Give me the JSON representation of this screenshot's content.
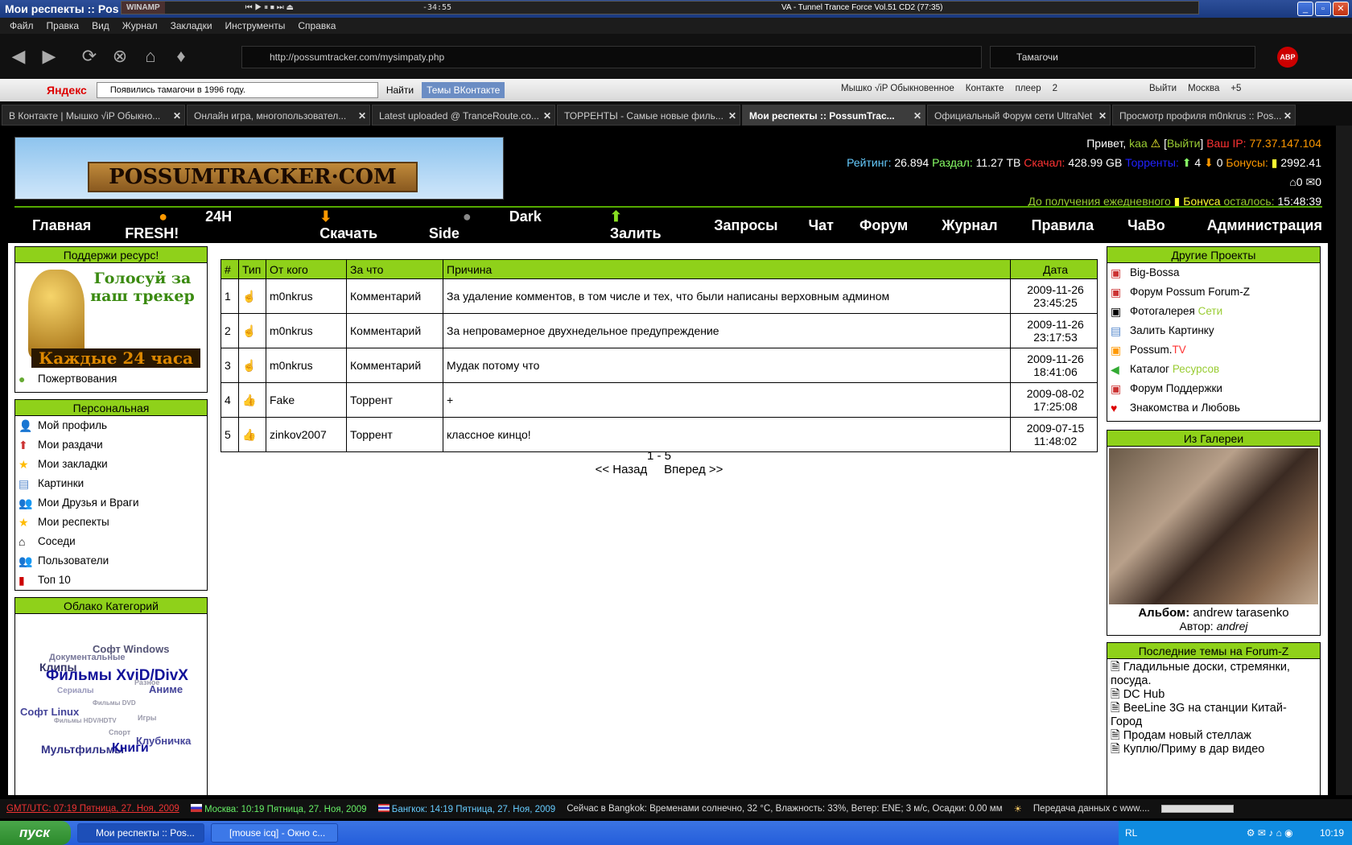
{
  "titlebar": {
    "title": "Мои респекты :: Pos",
    "winamp_label": "WINAMP",
    "winamp_time": "-34:55",
    "track": "VA - Tunnel Trance Force Vol.51 CD2 (77:35)"
  },
  "menu": [
    "Файл",
    "Правка",
    "Вид",
    "Журнал",
    "Закладки",
    "Инструменты",
    "Справка"
  ],
  "url": "http://possumtracker.com/mysimpaty.php",
  "search": "Тамагочи",
  "yandex": {
    "logo": "Яндекс",
    "query": "Появились тамагочи в 1996 году.",
    "find": "Найти",
    "vk_topics": "Темы ВКонтакте",
    "right": [
      "Мышко √iP Обыкновенное",
      "Контакте",
      "плеер",
      "2",
      "Выйти",
      "Москва",
      "+5"
    ]
  },
  "tabs": [
    "В Контакте | Мышко √iP Обыкно...",
    "Онлайн игра, многопользовател...",
    "Latest uploaded @ TranceRoute.co...",
    "ТОРРЕНТЫ - Самые новые филь...",
    "Мои респекты :: PossumTrac...",
    "Официальный Форум сети UltraNet",
    "Просмотр профиля m0nkrus :: Pos..."
  ],
  "banner": "POSSUMTRACKER·COM",
  "user": {
    "hello": "Привет,",
    "name": "kaa",
    "logout": "Выйти",
    "ip_label": "Ваш IP:",
    "ip": "77.37.147.104",
    "rating_label": "Рейтинг:",
    "rating": "26.894",
    "up_label": "Раздал:",
    "up": "11.27 TB",
    "down_label": "Скачал:",
    "down": "428.99 GB",
    "torrents_label": "Торренты:",
    "t_up": "4",
    "t_down": "0",
    "bonus_label": "Бонусы:",
    "bonus": "2992.41",
    "inbox": "0",
    "outbox": "0",
    "daily_1": "До получения ежедневного",
    "daily_2": "Бонуса",
    "daily_3": "осталось:",
    "daily_time": "15:48:39"
  },
  "nav": [
    "Главная",
    "24H FRESH!",
    "Скачать",
    "Dark Side",
    "Залить",
    "Запросы",
    "Чат",
    "Форум",
    "Журнал",
    "Правила",
    "ЧаВо",
    "Администрация"
  ],
  "support": {
    "title": "Поддержи ресурс!",
    "vote": "Голосуй за наш трекер",
    "every": "Каждые 24 часа",
    "donate": "Пожертвования"
  },
  "personal": {
    "title": "Персональная",
    "items": [
      "Мой профиль",
      "Мои раздачи",
      "Мои закладки",
      "Картинки",
      "Мои Друзья и Враги",
      "Мои респекты",
      "Соседи",
      "Пользователи",
      "Топ 10"
    ]
  },
  "cloud": {
    "title": "Облако Категорий",
    "tags": [
      "Софт Windows",
      "Документальные",
      "Клипы",
      "Фильмы XviD/DivX",
      "Разное",
      "Аниме",
      "Сериалы",
      "Фильмы DVD",
      "Софт Linux",
      "Фильмы HDV/HDTV",
      "Игры",
      "Спорт",
      "Клубничка",
      "Мультфильмы",
      "Книги"
    ]
  },
  "table": {
    "headers": [
      "#",
      "Тип",
      "От кого",
      "За что",
      "Причина",
      "Дата"
    ],
    "rows": [
      [
        "1",
        "m0nkrus",
        "Комментарий",
        "За удаление комментов, в том числе и тех, что были написаны верховным админом",
        "2009-11-26",
        "23:45:25"
      ],
      [
        "2",
        "m0nkrus",
        "Комментарий",
        "За непровамерное двухнедельное предупреждение",
        "2009-11-26",
        "23:17:53"
      ],
      [
        "3",
        "m0nkrus",
        "Комментарий",
        "Мудак потому что",
        "2009-11-26",
        "18:41:06"
      ],
      [
        "4",
        "Fake",
        "Торрент",
        "+",
        "2009-08-02",
        "17:25:08"
      ],
      [
        "5",
        "zinkov2007",
        "Торрент",
        "классное кинцо!",
        "2009-07-15",
        "11:48:02"
      ]
    ]
  },
  "pager": {
    "range": "1 - 5",
    "prev": "<< Назад",
    "next": "Вперед >>"
  },
  "projects": {
    "title": "Другие Проекты",
    "items": [
      [
        "Big-Bossa",
        ""
      ],
      [
        "Форум Possum Forum-Z",
        ""
      ],
      [
        "Фотогалерея ",
        "Сети"
      ],
      [
        "Залить Картинку",
        ""
      ],
      [
        "Possum.",
        "TV"
      ],
      [
        "Каталог ",
        "Ресурсов"
      ],
      [
        "Форум Поддержки",
        ""
      ],
      [
        "Знакомства и Любовь",
        ""
      ]
    ]
  },
  "gallery": {
    "title": "Из Галереи",
    "album_label": "Альбом:",
    "album": "andrew tarasenko",
    "author_label": "Автор:",
    "author": "andrej"
  },
  "forum": {
    "title": "Последние темы на Forum-Z",
    "items": [
      "Гладильные доски, стремянки, посуда.",
      "DC Hub",
      "BeeLine 3G на станции Китай-Город",
      "Продам новый стеллаж",
      "Куплю/Приму в дар видео"
    ]
  },
  "status": {
    "gmt": "GMT/UTC: 07:19 Пятница, 27. Ноя, 2009",
    "moscow": "Москва: 10:19 Пятница, 27. Ноя, 2009",
    "bangkok": "Бангкок: 14:19 Пятница, 27. Ноя, 2009",
    "weather": "Сейчас в Bangkok: Временами солнечно, 32 °C, Влажность: 33%, Ветер: ENE; 3 м/с, Осадки: 0.00 мм",
    "transfer": "Передача данных с www...."
  },
  "taskbar": {
    "start": "пуск",
    "tasks": [
      "Мои респекты :: Pos...",
      "[mouse icq] - Окно с..."
    ],
    "lang": "RL",
    "clock": "10:19"
  }
}
